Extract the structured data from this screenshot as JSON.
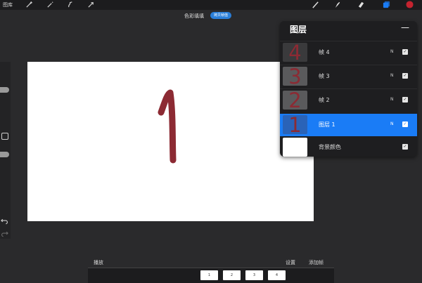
{
  "topbar": {
    "gallery_label": "图库"
  },
  "colors": {
    "accent": "#1a7cf6",
    "stroke": "#8c2a33",
    "active_color": "#c4232f",
    "badge": "#2a7fd9"
  },
  "title": {
    "text": "色彩填填",
    "badge": "拷贝帧值"
  },
  "layers": {
    "title": "图层",
    "add_symbol": "—",
    "rows": [
      {
        "thumb": "4",
        "name": "帧 4",
        "mode": "N",
        "check": "✓"
      },
      {
        "thumb": "3",
        "name": "帧 3",
        "mode": "N",
        "check": "✓"
      },
      {
        "thumb": "2",
        "name": "帧 2",
        "mode": "N",
        "check": "✓"
      },
      {
        "thumb": "1",
        "name": "图层 1",
        "mode": "N",
        "check": "✓"
      },
      {
        "thumb": "",
        "name": "背景颜色",
        "mode": "",
        "check": "✓"
      }
    ]
  },
  "bottom": {
    "playback": "播放",
    "settings": "设置",
    "add_frame": "添加帧"
  },
  "timeline": {
    "frames": [
      "1",
      "2",
      "3",
      "4"
    ]
  }
}
